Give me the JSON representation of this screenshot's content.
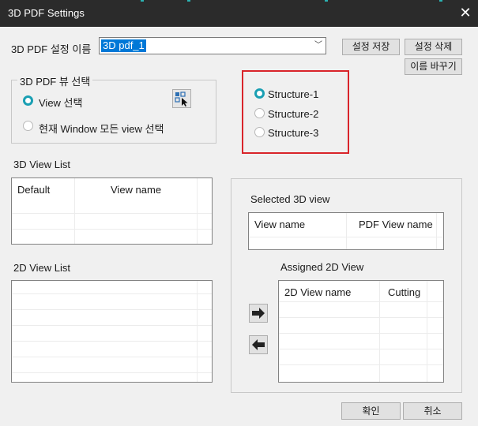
{
  "window": {
    "title": "3D PDF Settings",
    "close_icon": "close-icon"
  },
  "settings_name": {
    "label": "3D PDF 설정 이름",
    "value": "3D pdf_1",
    "save_button": "설정 저장",
    "delete_button": "설정 삭제",
    "rename_button": "이름 바꾸기"
  },
  "view_select_group": {
    "title": "3D PDF 뷰 선택",
    "option_view": "View 선택",
    "option_all": "현재 Window 모든 view 선택",
    "selected": "View 선택"
  },
  "structures": {
    "options": [
      "Structure-1",
      "Structure-2",
      "Structure-3"
    ],
    "selected": "Structure-1",
    "highlight_color": "#d9242a"
  },
  "view3d_list": {
    "label": "3D View List",
    "columns": [
      "Default",
      "View name"
    ]
  },
  "view2d_list": {
    "label": "2D View List"
  },
  "selected_3d": {
    "label": "Selected 3D view",
    "columns": [
      "View name",
      "PDF View name"
    ]
  },
  "assigned_2d": {
    "label": "Assigned 2D View",
    "columns": [
      "2D View name",
      "Cutting"
    ]
  },
  "footer": {
    "ok": "확인",
    "cancel": "취소"
  },
  "colors": {
    "radio_accent": "#1a9fb3",
    "selection": "#0078d7",
    "titlebar": "#2b2b2b"
  }
}
